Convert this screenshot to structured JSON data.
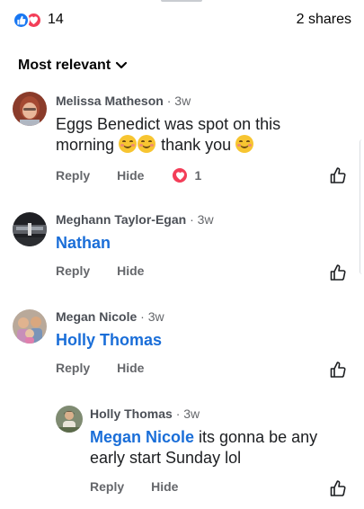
{
  "reactions": {
    "count": "14",
    "shares": "2 shares",
    "like_color": "#1877f2",
    "love_color": "#f33e58"
  },
  "sort": {
    "label": "Most relevant"
  },
  "comments": [
    {
      "author": "Melissa Matheson",
      "time": "3w",
      "text_parts": [
        "Eggs Benedict was spot on this",
        "morning",
        "thank you"
      ],
      "reply": "Reply",
      "hide": "Hide",
      "reaction_count": "1"
    },
    {
      "author": "Meghann Taylor-Egan",
      "time": "3w",
      "mention": "Nathan",
      "reply": "Reply",
      "hide": "Hide"
    },
    {
      "author": "Megan Nicole",
      "time": "3w",
      "mention": "Holly Thomas",
      "reply": "Reply",
      "hide": "Hide"
    },
    {
      "author": "Holly Thomas",
      "time": "3w",
      "mention": "Megan Nicole",
      "text_line1": " its gonna be any",
      "text_line2": "early start Sunday lol",
      "reply": "Reply",
      "hide": "Hide"
    }
  ],
  "icons": {
    "like": "thumbs-up-icon",
    "love": "heart-icon",
    "sort": "chevron-down-icon"
  }
}
